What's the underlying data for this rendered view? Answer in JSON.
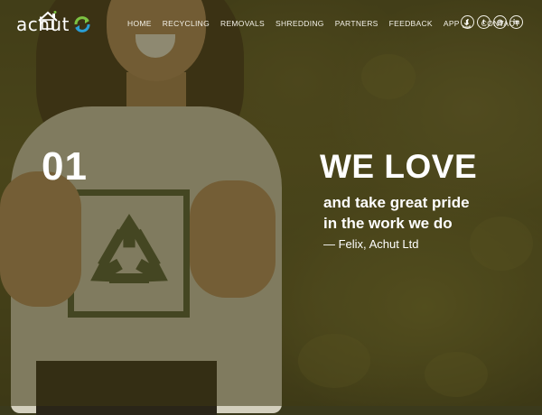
{
  "logo": {
    "text": "achut",
    "house_icon": "house-icon",
    "recycle_icon": "recycle-icon"
  },
  "nav": {
    "items": [
      {
        "label": "HOME"
      },
      {
        "label": "RECYCLING"
      },
      {
        "label": "REMOVALS"
      },
      {
        "label": "SHREDDING"
      },
      {
        "label": "PARTNERS"
      },
      {
        "label": "FEEDBACK"
      },
      {
        "label": "APP",
        "icon": "download-icon"
      },
      {
        "label": "CONTACT"
      }
    ]
  },
  "social": {
    "items": [
      {
        "name": "facebook-icon",
        "glyph": "f"
      },
      {
        "name": "twitter-icon",
        "glyph": "t"
      },
      {
        "name": "instagram-icon",
        "glyph": "◎"
      },
      {
        "name": "linkedin-icon",
        "glyph": "in"
      }
    ]
  },
  "hero": {
    "slide_number": "01",
    "headline": "WE LOVE",
    "subline": [
      "and take great pride",
      "in the work we do"
    ],
    "attribution": "— Felix, Achut Ltd"
  },
  "colors": {
    "tint": "#3c3712",
    "text": "#ffffff",
    "logo_accent_green": "#7cc242",
    "logo_accent_blue": "#2a9fd6"
  }
}
